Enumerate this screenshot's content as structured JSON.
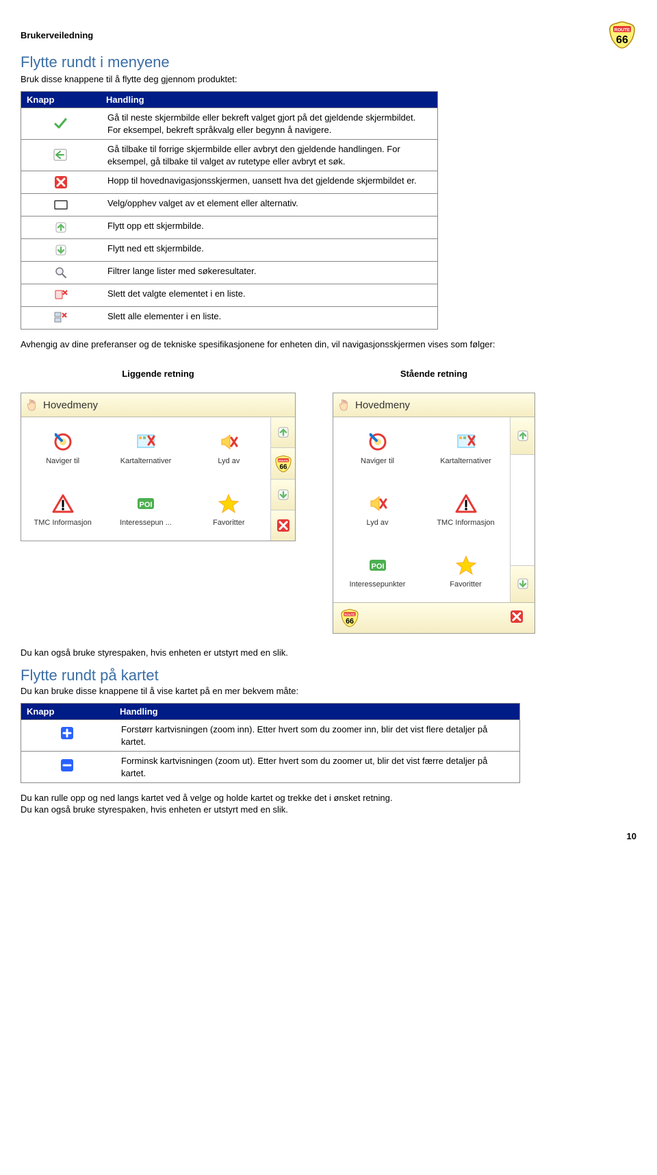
{
  "header": {
    "doc_title": "Brukerveiledning"
  },
  "section1": {
    "title": "Flytte rundt i menyene",
    "intro": "Bruk disse knappene til å flytte deg gjennom produktet:",
    "table": {
      "col1": "Knapp",
      "col2": "Handling",
      "rows": [
        {
          "icon": "check",
          "text": "Gå til neste skjermbilde eller bekreft valget gjort på det gjeldende skjermbildet. For eksempel, bekreft språkvalg eller begynn å navigere."
        },
        {
          "icon": "back",
          "text": "Gå tilbake til forrige skjermbilde eller avbryt den gjeldende handlingen. For eksempel, gå tilbake til valget av rutetype eller avbryt et søk."
        },
        {
          "icon": "close",
          "text": "Hopp til hovednavigasjonsskjermen, uansett hva det gjeldende skjermbildet er."
        },
        {
          "icon": "checkbox",
          "text": "Velg/opphev valget av et element eller alternativ."
        },
        {
          "icon": "arrow-up",
          "text": "Flytt opp ett skjermbilde."
        },
        {
          "icon": "arrow-down",
          "text": "Flytt ned ett skjermbilde."
        },
        {
          "icon": "filter",
          "text": "Filtrer lange lister med søkeresultater."
        },
        {
          "icon": "trash-one",
          "text": "Slett det valgte elementet i en liste."
        },
        {
          "icon": "trash-all",
          "text": "Slett alle elementer i en liste."
        }
      ]
    },
    "after_table": "Avhengig av dine preferanser og de tekniske spesifikasjonene for enheten din, vil navigasjonsskjermen vises som følger:",
    "orientation": {
      "landscape_label": "Liggende retning",
      "portrait_label": "Stående retning",
      "titlebar": "Hovedmeny",
      "landscape_items": [
        {
          "label": "Naviger til",
          "icon": "target"
        },
        {
          "label": "Kartalternativer",
          "icon": "map"
        },
        {
          "label": "Lyd av",
          "icon": "soundoff"
        },
        {
          "label": "TMC Informasjon",
          "icon": "warn"
        },
        {
          "label": "Interessepun ...",
          "icon": "poi"
        },
        {
          "label": "Favoritter",
          "icon": "star"
        }
      ],
      "portrait_items": [
        {
          "label": "Naviger til",
          "icon": "target"
        },
        {
          "label": "Kartalternativer",
          "icon": "map"
        },
        {
          "label": "Lyd av",
          "icon": "soundoff"
        },
        {
          "label": "TMC Informasjon",
          "icon": "warn"
        },
        {
          "label": "Interessepunkter",
          "icon": "poi"
        },
        {
          "label": "Favoritter",
          "icon": "star"
        }
      ]
    },
    "after_orient": "Du kan også bruke styrespaken, hvis enheten er utstyrt med en slik."
  },
  "section2": {
    "title": "Flytte rundt på kartet",
    "intro": "Du kan bruke disse knappene til å vise kartet på en mer bekvem måte:",
    "table": {
      "col1": "Knapp",
      "col2": "Handling",
      "rows": [
        {
          "icon": "plus",
          "text": "Forstørr kartvisningen (zoom inn). Etter hvert som du zoomer inn, blir det vist flere detaljer på kartet."
        },
        {
          "icon": "minus",
          "text": "Forminsk kartvisningen (zoom ut). Etter hvert som du zoomer ut, blir det vist færre detaljer på kartet."
        }
      ]
    },
    "after1": "Du kan rulle opp og ned langs kartet ved å velge og holde kartet og trekke det i ønsket retning.",
    "after2": "Du kan også bruke styrespaken, hvis enheten er utstyrt med en slik."
  },
  "page_number": "10"
}
